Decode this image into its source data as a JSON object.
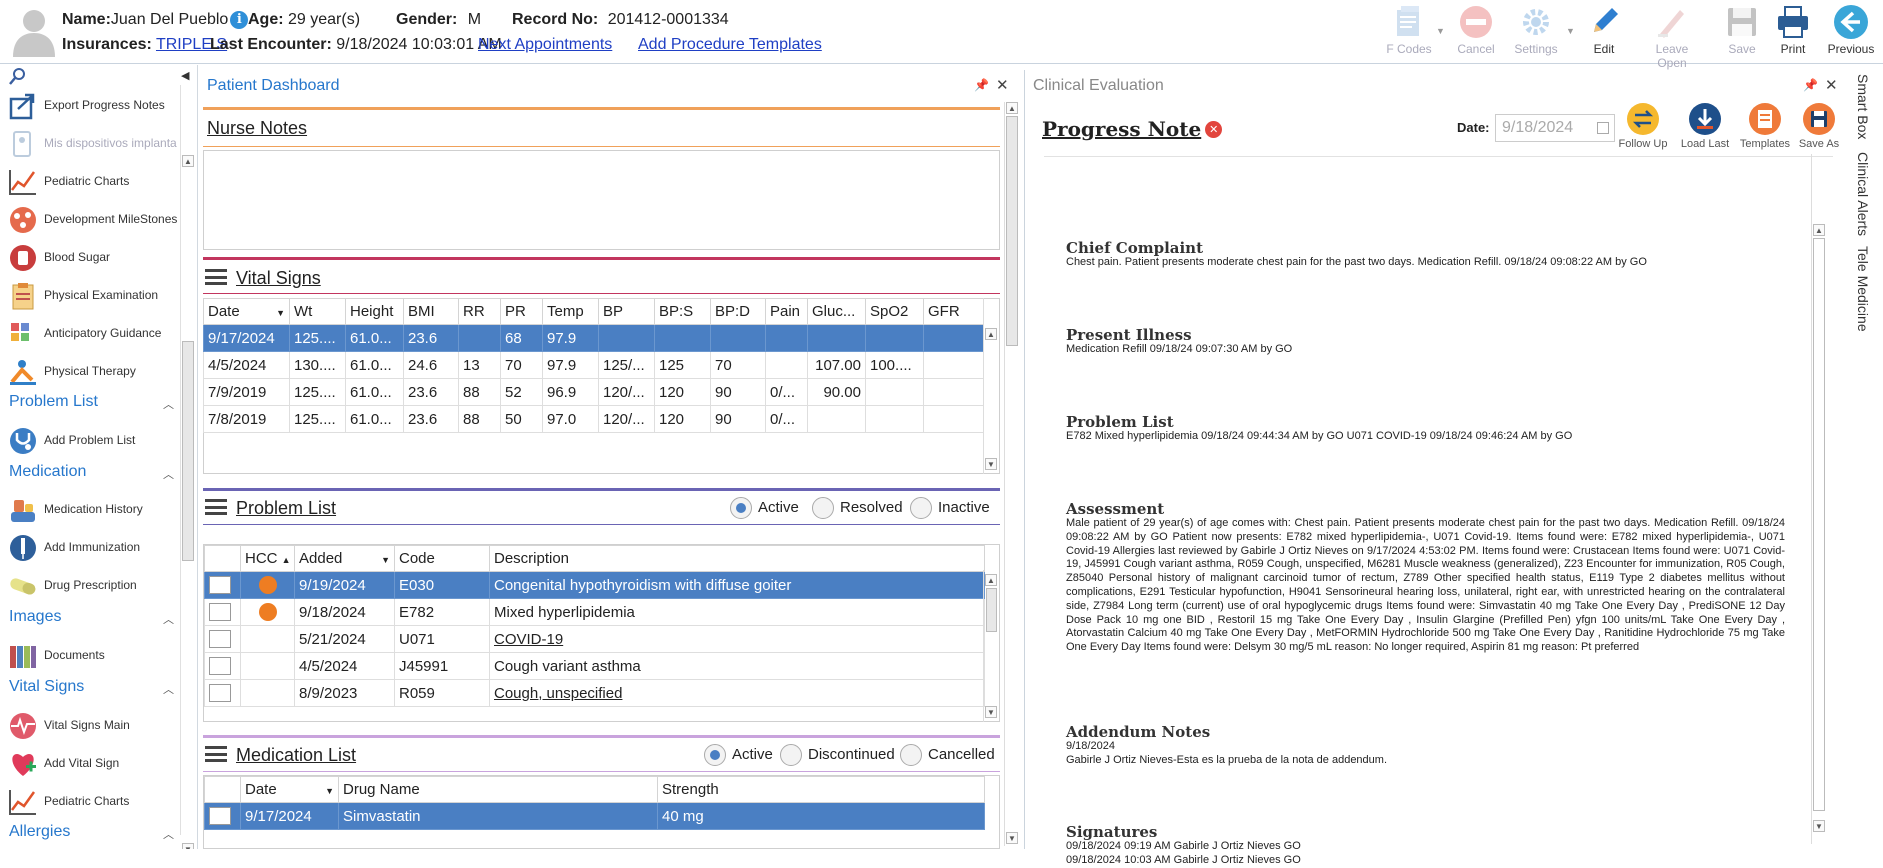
{
  "header": {
    "name_label": "Name:",
    "name_value": "Juan Del Pueblo",
    "age_label": "Age:",
    "age_value": "29 year(s)",
    "gender_label": "Gender:",
    "gender_value": "M",
    "record_label": "Record No:",
    "record_value": "201412-0001334",
    "insurances_label": "Insurances:",
    "insurances_value": "TRIPLE S",
    "last_encounter_label": "Last Encounter:",
    "last_encounter_value": "9/18/2024 10:03:01 AM",
    "next_appointments": "Next Appointments",
    "add_procedure_templates": "Add Procedure Templates"
  },
  "toolbar": {
    "fcodes": "F Codes",
    "cancel": "Cancel",
    "settings": "Settings",
    "edit": "Edit",
    "leave_open": "Leave Open",
    "save": "Save",
    "print": "Print",
    "previous": "Previous"
  },
  "nav": {
    "items_top": [
      {
        "label": "Export Progress Notes"
      },
      {
        "label": "Mis dispositivos implanta"
      },
      {
        "label": "Pediatric Charts"
      },
      {
        "label": "Development MileStones"
      },
      {
        "label": "Blood Sugar"
      },
      {
        "label": "Physical Examination"
      },
      {
        "label": "Anticipatory Guidance"
      },
      {
        "label": "Physical Therapy"
      }
    ],
    "sections": {
      "problem_list": "Problem List",
      "medication": "Medication",
      "images": "Images",
      "vital_signs": "Vital Signs",
      "allergies": "Allergies"
    },
    "add_problem_list": "Add Problem List",
    "medication_history": "Medication History",
    "add_immunization": "Add Immunization",
    "drug_prescription": "Drug Prescription",
    "documents": "Documents",
    "vital_signs_main": "Vital Signs Main",
    "add_vital_sign": "Add Vital Sign",
    "pediatric_charts_2": "Pediatric Charts"
  },
  "dashboard": {
    "title": "Patient Dashboard",
    "nurse_notes": "Nurse Notes",
    "vital_signs": {
      "title": "Vital Signs",
      "columns": [
        "Date",
        "Wt",
        "Height",
        "BMI",
        "RR",
        "PR",
        "Temp",
        "BP",
        "BP:S",
        "BP:D",
        "Pain",
        "Gluc...",
        "SpO2",
        "GFR"
      ],
      "rows": [
        [
          "9/17/2024",
          "125....",
          "61.0...",
          "23.6",
          "",
          "68",
          "97.9",
          "",
          "",
          "",
          "",
          "",
          "",
          ""
        ],
        [
          "4/5/2024",
          "130....",
          "61.0...",
          "24.6",
          "13",
          "70",
          "97.9",
          "125/...",
          "125",
          "70",
          "",
          "107.00",
          "100....",
          ""
        ],
        [
          "7/9/2019",
          "125....",
          "61.0...",
          "23.6",
          "88",
          "52",
          "96.9",
          "120/...",
          "120",
          "90",
          "0/...",
          "90.00",
          "",
          ""
        ],
        [
          "7/8/2019",
          "125....",
          "61.0...",
          "23.6",
          "88",
          "50",
          "97.0",
          "120/...",
          "120",
          "90",
          "0/...",
          "",
          "",
          ""
        ]
      ]
    },
    "problem_list": {
      "title": "Problem List",
      "filter_active": "Active",
      "filter_resolved": "Resolved",
      "filter_inactive": "Inactive",
      "columns": [
        "",
        "HCC",
        "Added",
        "Code",
        "Description"
      ],
      "rows": [
        {
          "hcc": true,
          "added": "9/19/2024",
          "code": "E030",
          "desc": "Congenital hypothyroidism with diffuse goiter",
          "link": false
        },
        {
          "hcc": true,
          "added": "9/18/2024",
          "code": "E782",
          "desc": "Mixed hyperlipidemia",
          "link": false
        },
        {
          "hcc": false,
          "added": "5/21/2024",
          "code": "U071",
          "desc": "COVID-19",
          "link": true
        },
        {
          "hcc": false,
          "added": "4/5/2024",
          "code": "J45991",
          "desc": "Cough variant asthma",
          "link": false
        },
        {
          "hcc": false,
          "added": "8/9/2023",
          "code": "R059",
          "desc": "Cough, unspecified",
          "link": true
        }
      ]
    },
    "medication_list": {
      "title": "Medication List",
      "filter_active": "Active",
      "filter_discontinued": "Discontinued",
      "filter_cancelled": "Cancelled",
      "columns": [
        "",
        "Date",
        "Drug Name",
        "Strength"
      ],
      "rows": [
        {
          "date": "9/17/2024",
          "drug": "Simvastatin",
          "strength": "40 mg"
        }
      ]
    }
  },
  "clinical": {
    "title": "Clinical Evaluation",
    "progress_note": "Progress Note",
    "date_label": "Date:",
    "date_value": "9/18/2024",
    "buttons": {
      "follow_up": "Follow Up",
      "load_last": "Load Last",
      "templates": "Templates",
      "save_as": "Save As"
    },
    "sections": {
      "chief_complaint": {
        "title": "Chief Complaint",
        "body": "Chest pain. Patient presents moderate chest pain for the past two days. Medication Refill. 09/18/24 09:08:22 AM by GO"
      },
      "present_illness": {
        "title": "Present Illness",
        "body": "Medication Refill 09/18/24 09:07:30 AM by GO"
      },
      "problem_list": {
        "title": "Problem List",
        "body": "E782 Mixed hyperlipidemia 09/18/24 09:44:34 AM by GO U071 COVID-19 09/18/24 09:46:24 AM by GO"
      },
      "assessment": {
        "title": "Assessment",
        "body": "Male patient of 29 year(s) of age comes with: Chest pain. Patient presents moderate chest pain for the past two days. Medication Refill. 09/18/24 09:08:22 AM by GO Patient now presents: E782 mixed hyperlipidemia-, U071 Covid-19. Items found were: E782 mixed hyperlipidemia-, U071 Covid-19 Allergies last reviewed by Gabirle J Ortiz Nieves on 9/17/2024 4:53:02 PM. Items found were: Crustacean Items found were: U071 Covid-19, J45991 Cough variant asthma, R059 Cough, unspecified, M6281 Muscle weakness (generalized), Z23 Encounter for immunization, R05 Cough, Z85040 Personal history of malignant carcinoid tumor of rectum, Z789 Other specified health status, E119 Type 2 diabetes mellitus without complications, E291 Testicular hypofunction, H9041 Sensorineural hearing loss, unilateral, right ear, with unrestricted hearing on the contralateral side, Z7984 Long term (current) use of oral hypoglycemic drugs Items found were: Simvastatin 40 mg Take One Every Day , PrediSONE 12 Day Dose Pack 10 mg one BID , Restoril 15 mg Take One Every Day , Insulin Glargine (Prefilled Pen) yfgn 100 units/mL Take One Every Day , Atorvastatin Calcium 40 mg Take One Every Day , MetFORMIN Hydrochloride 500 mg Take One Every Day , Ranitidine Hydrochloride 75 mg Take One Every Day Items found were: Delsym 30 mg/5 mL reason: No longer required, Aspirin 81 mg reason: Pt preferred"
      },
      "addendum": {
        "title": "Addendum Notes",
        "date": "9/18/2024",
        "body": "Gabirle J Ortiz Nieves-Esta es la prueba de la nota de addendum."
      },
      "signatures": {
        "title": "Signatures",
        "line1": "09/18/2024 09:19 AM Gabirle J Ortiz Nieves GO",
        "line2": "09/18/2024 10:03 AM Gabirle J Ortiz Nieves GO"
      }
    }
  },
  "side_tabs": {
    "smart_box": "Smart Box",
    "clinical_alerts": "Clinical Alerts",
    "tele_medicine": "Tele Medicine"
  },
  "colors": {
    "accent_blue": "#2677cc",
    "selected_row": "#4a7fc3",
    "nurse_bar": "#f0a15a",
    "vitals_bar": "#c2355e",
    "problem_bar": "#6a64b4",
    "med_bar": "#c9a3dd"
  }
}
